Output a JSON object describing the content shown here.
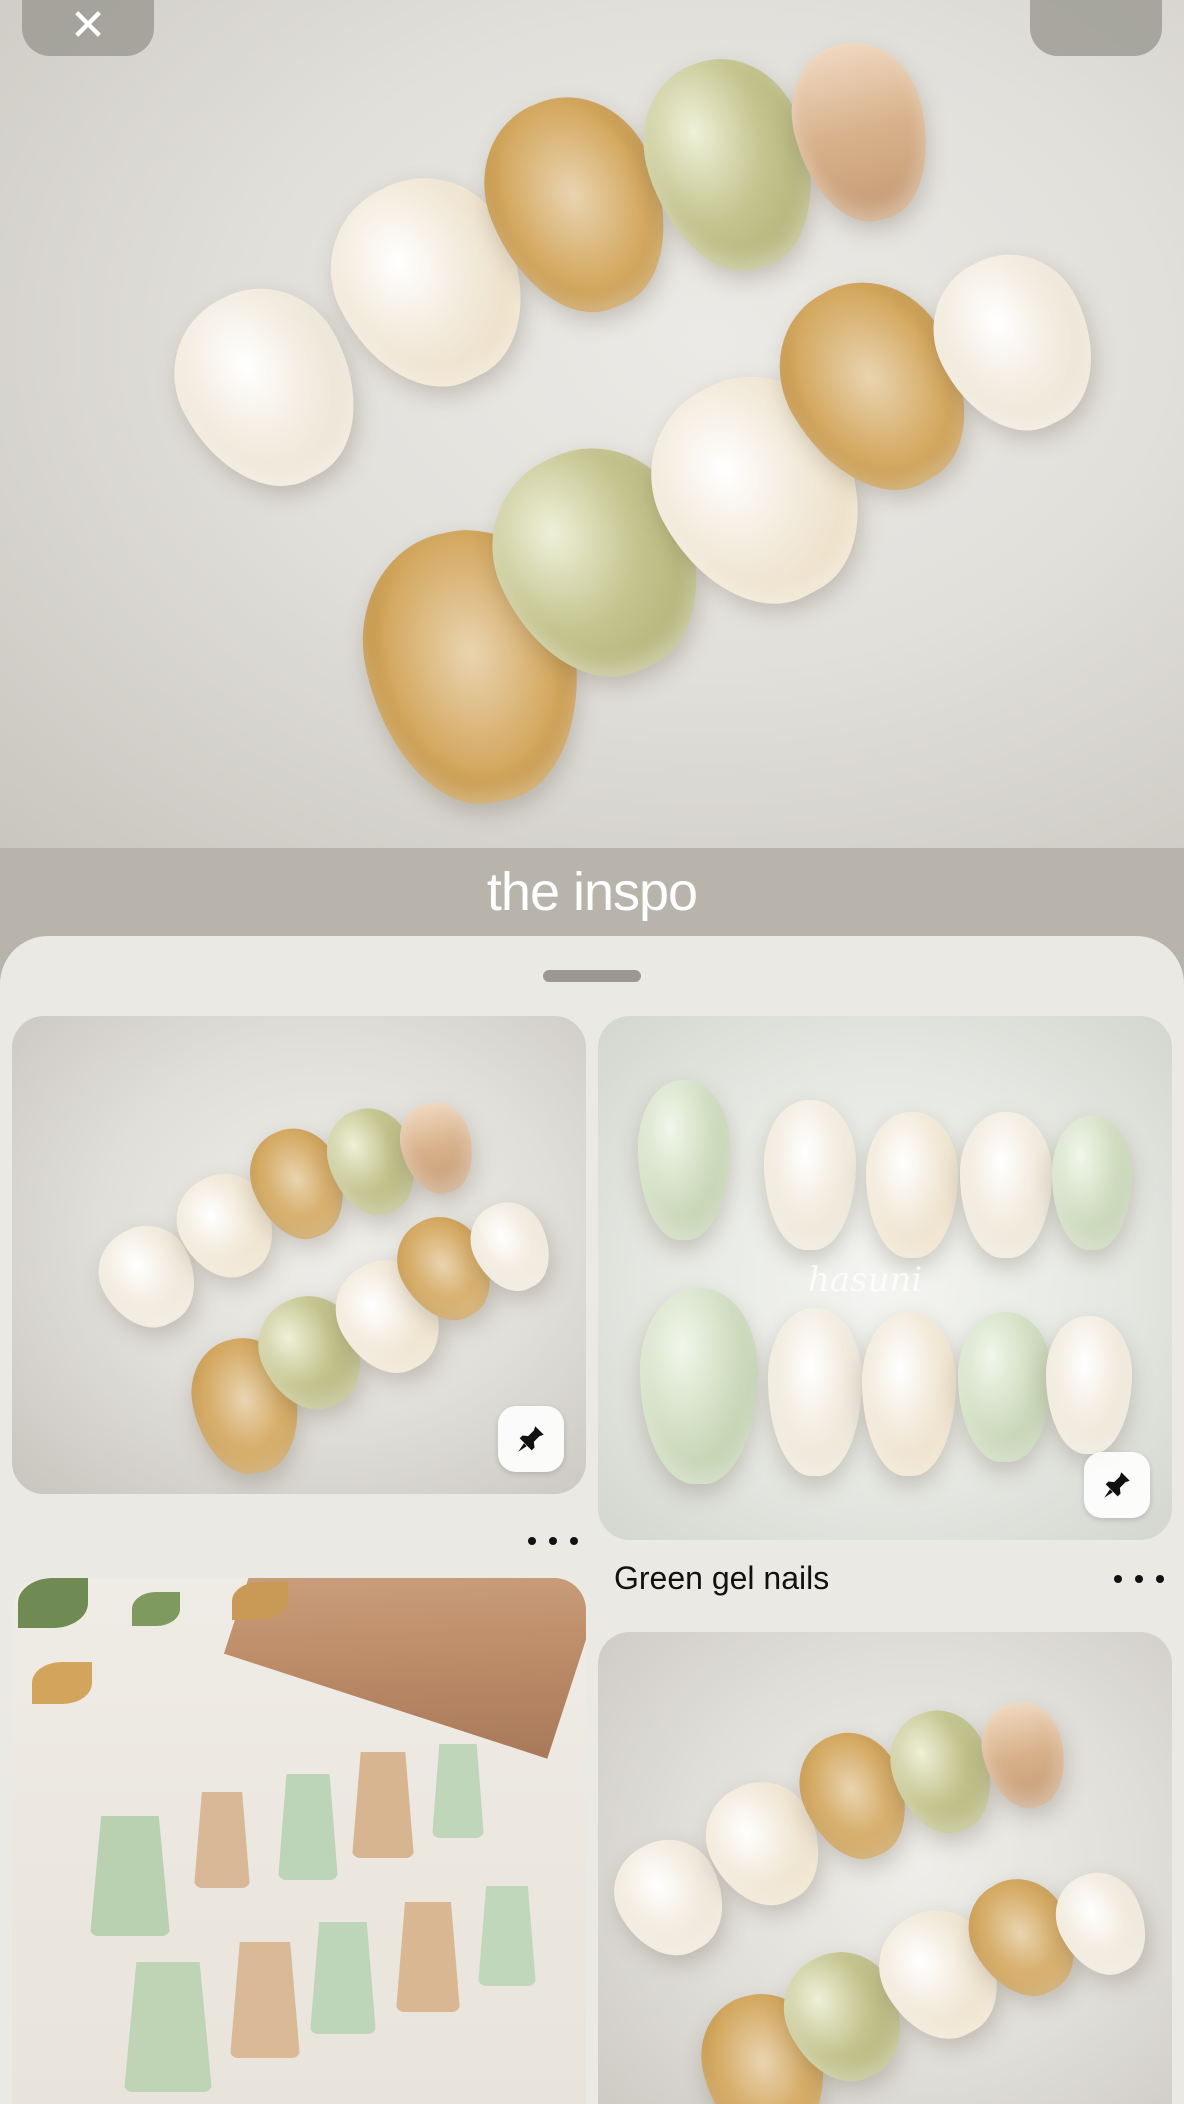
{
  "header": {
    "close_icon": "close-icon",
    "options_icon": "more-options-icon"
  },
  "board": {
    "title": "the inspo"
  },
  "pins": [
    {
      "title": "",
      "save_icon": "pin-icon",
      "more_icon": "more-horizontal-icon"
    },
    {
      "title": "Green gel nails",
      "save_icon": "pin-icon",
      "more_icon": "more-horizontal-icon",
      "watermark": "hasuni"
    },
    {
      "title": "",
      "save_icon": "pin-icon"
    },
    {
      "title": "",
      "save_icon": "pin-icon"
    }
  ],
  "colors": {
    "backdrop": "#b8b4ab",
    "sheet": "#ebe9e4",
    "title_text": "#ffffff"
  }
}
